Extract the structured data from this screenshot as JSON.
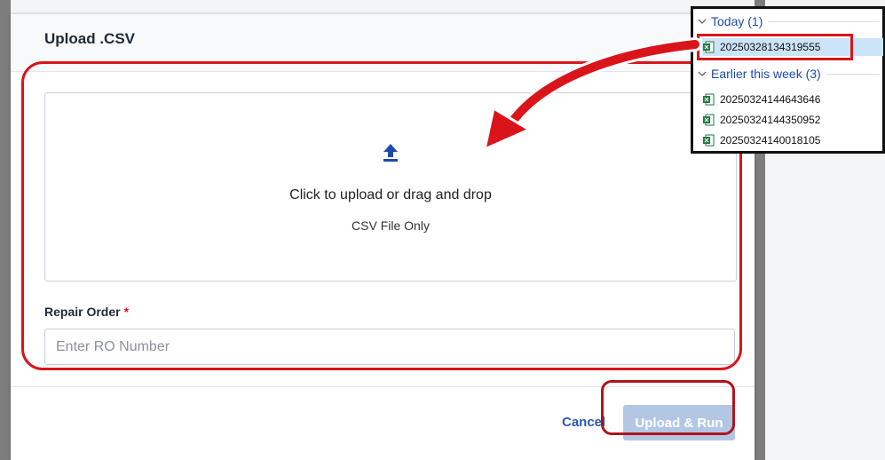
{
  "modal": {
    "title": "Upload .CSV",
    "dropzone": {
      "primary_text": "Click to upload or drag and drop",
      "secondary_text": "CSV File Only",
      "icon": "upload-icon"
    },
    "repair_order": {
      "label": "Repair Order",
      "required_marker": "*",
      "placeholder": "Enter RO Number",
      "value": ""
    },
    "footer": {
      "cancel_label": "Cancel",
      "upload_label": "Upload & Run",
      "upload_disabled": true
    }
  },
  "file_explorer": {
    "groups": [
      {
        "header": "Today (1)",
        "files": [
          {
            "name": "20250328134319555",
            "icon": "excel-file-icon",
            "selected": true
          }
        ]
      },
      {
        "header": "Earlier this week (3)",
        "files": [
          {
            "name": "20250324144643646",
            "icon": "excel-file-icon",
            "selected": false
          },
          {
            "name": "20250324144350952",
            "icon": "excel-file-icon",
            "selected": false
          },
          {
            "name": "20250324140018105",
            "icon": "excel-file-icon",
            "selected": false
          }
        ]
      }
    ]
  },
  "colors": {
    "highlight_red": "#d9151b",
    "link_blue": "#2b56b4",
    "disabled_button": "#b3c6e4",
    "excel_green": "#1f7a3f"
  }
}
